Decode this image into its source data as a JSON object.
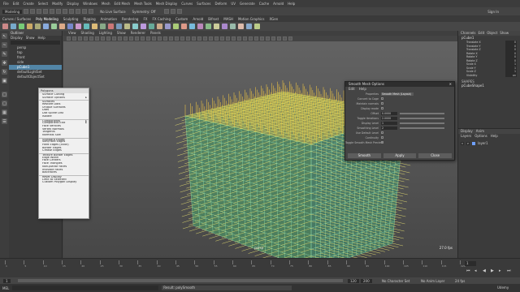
{
  "menubar": [
    "File",
    "Edit",
    "Create",
    "Select",
    "Modify",
    "Display",
    "Windows",
    "Mesh",
    "Edit Mesh",
    "Mesh Tools",
    "Mesh Display",
    "Curves",
    "Surfaces",
    "Deform",
    "UV",
    "Generate",
    "Cache",
    "Arnold",
    "Help"
  ],
  "statusline": {
    "mode": "Modeling",
    "no_live": "No Live Surface",
    "symmetry": "Symmetry: Off",
    "sign_in": "Sign In"
  },
  "shelf_tabs": [
    "Curves / Surfaces",
    "Poly Modeling",
    "Sculpting",
    "Rigging",
    "Animation",
    "Rendering",
    "FX",
    "FX Caching",
    "Custom",
    "Arnold",
    "Bifrost",
    "MASH",
    "Motion Graphics",
    "XGen"
  ],
  "outliner": {
    "title": "Outliner",
    "menus": [
      "Display",
      "Show",
      "Help"
    ],
    "items": [
      "persp",
      "top",
      "front",
      "side",
      "pCube1",
      "defaultLightSet",
      "defaultObjectSet"
    ],
    "selected_index": 4
  },
  "viewport": {
    "menus": [
      "View",
      "Shading",
      "Lighting",
      "Show",
      "Renderer",
      "Panels"
    ],
    "fps": "27.0 fps",
    "camera": "persp"
  },
  "marking_menu": {
    "title": "Polygons",
    "items": [
      "Surface Cutting",
      "Surface Options",
      "Surfaces",
      "Restore Dots",
      "Unique Surfaces",
      "Dots",
      "Dot Spline Dist",
      "Isolate",
      "Components",
      "Component Edit",
      "Face Vertices",
      "Vertex Normals",
      "Tangents",
      "Normals Size",
      "Standard Edges",
      "Soft/Hard Edges",
      "Hard Edges (color)",
      "Border Edges",
      "Crease Edges",
      "Texture Border Edges",
      "Edge Width",
      "Face Centers",
      "Face Triangles",
      "Non-planar Faces",
      "Invisible Faces",
      "Backfaces",
      "Reset Display",
      "Limit to Selected",
      "Custom Polygon Display"
    ]
  },
  "dialog": {
    "title": "Smooth Mesh Options",
    "menus": [
      "Edit",
      "Help"
    ],
    "rows": [
      {
        "label": "Properties",
        "type": "drop",
        "value": "Smooth Mesh (Layout)"
      },
      {
        "label": "Convert to Cage",
        "type": "check",
        "value": ""
      },
      {
        "label": "Maintain normals",
        "type": "check",
        "value": ""
      },
      {
        "label": "Display mode",
        "type": "check",
        "value": ""
      },
      {
        "label": "Offset",
        "type": "field",
        "value": "0.0000"
      },
      {
        "label": "Toggle Iterations",
        "type": "field",
        "value": "2.0000"
      },
      {
        "label": "Display Level",
        "type": "field",
        "value": "1"
      },
      {
        "label": "Smoothing Level",
        "type": "field",
        "value": "2"
      },
      {
        "label": "Use Default Level",
        "type": "check",
        "value": ""
      },
      {
        "label": "Continuity",
        "type": "check",
        "value": ""
      },
      {
        "label": "Toggle Smooth Mesh Preview",
        "type": "check",
        "value": ""
      }
    ],
    "buttons": [
      "Smooth",
      "Apply",
      "Close"
    ]
  },
  "channel_box": {
    "tabs": [
      "Channels",
      "Edit",
      "Object",
      "Show"
    ],
    "object": "pCube1",
    "channels": [
      [
        "Translate X",
        "0"
      ],
      [
        "Translate Y",
        "0"
      ],
      [
        "Translate Z",
        "0"
      ],
      [
        "Rotate X",
        "0"
      ],
      [
        "Rotate Y",
        "0"
      ],
      [
        "Rotate Z",
        "0"
      ],
      [
        "Scale X",
        "1"
      ],
      [
        "Scale Y",
        "1"
      ],
      [
        "Scale Z",
        "1"
      ],
      [
        "Visibility",
        "on"
      ]
    ],
    "shapes_label": "SHAPES",
    "shape_name": "pCubeShape1"
  },
  "layers": {
    "tabs": [
      "Display",
      "Anim"
    ],
    "menus": [
      "Layers",
      "Options",
      "Help"
    ],
    "layer": "layer1"
  },
  "timeline": {
    "ticks": [
      "1",
      "5",
      "10",
      "15",
      "20",
      "25",
      "30",
      "35",
      "40",
      "45",
      "50",
      "55",
      "60",
      "65",
      "70",
      "75",
      "80",
      "85",
      "90",
      "95",
      "100",
      "105",
      "110",
      "115",
      "120"
    ],
    "current_frame": "1"
  },
  "range": {
    "start": "1",
    "end": "120",
    "anim_end": "200",
    "char_set": "No Character Set",
    "anim_layer": "No Anim Layer",
    "fps": "24 fps"
  },
  "command": {
    "label": "MEL",
    "message": "Result: polySmooth"
  },
  "watermark": "Udemy",
  "colors": {
    "accent": "#5285a6",
    "grid_top": "#ffd040",
    "grid_face": "#5fd3a0"
  }
}
